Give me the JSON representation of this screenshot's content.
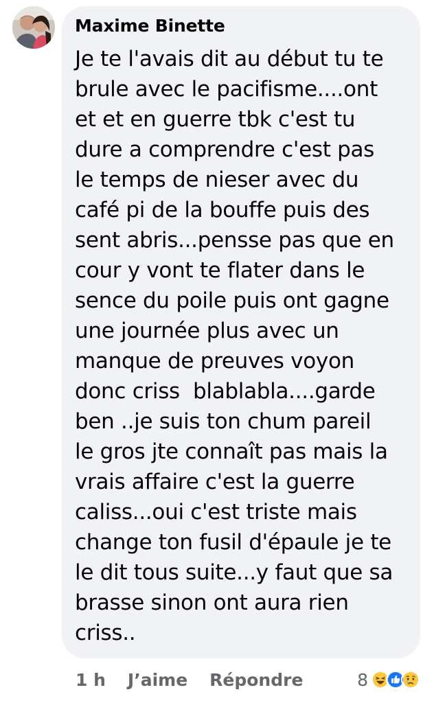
{
  "comment": {
    "author": "Maxime Binette",
    "avatar_icon": "profile-photo-avatar",
    "lines": [
      "Je te l'avais dit au début tu te",
      "brule avec le pacifisme....ont",
      "et et en guerre tbk c'est tu",
      "dure a comprendre c'est pas",
      "le temps de nieser avec du",
      "café pi de la bouffe puis des",
      "sent abris...pensse pas que en",
      "cour y vont te flater dans le",
      "sence du poile puis ont gagne",
      "une journée plus avec un",
      "manque de preuves voyon",
      "donc criss  blablabla....garde",
      "ben ..je suis ton chum pareil",
      "le gros jte connaît pas mais la",
      "vrais affaire c'est la guerre",
      "caliss...oui c'est triste mais",
      "change ton fusil d'épaule je te",
      "le dit tous suite...y faut que sa",
      "brasse sinon ont aura rien",
      "criss.."
    ]
  },
  "actions": {
    "time": "1 h",
    "like_label": "J’aime",
    "reply_label": "Répondre"
  },
  "reactions": {
    "count": "8",
    "icons": [
      "haha-reaction-icon",
      "like-reaction-icon",
      "sad-reaction-icon"
    ]
  },
  "colors": {
    "bubble": "#f0f2f5",
    "meta_text": "#65676b",
    "like_blue": "#1877f2",
    "emoji_yellow": "#fcc83b"
  }
}
